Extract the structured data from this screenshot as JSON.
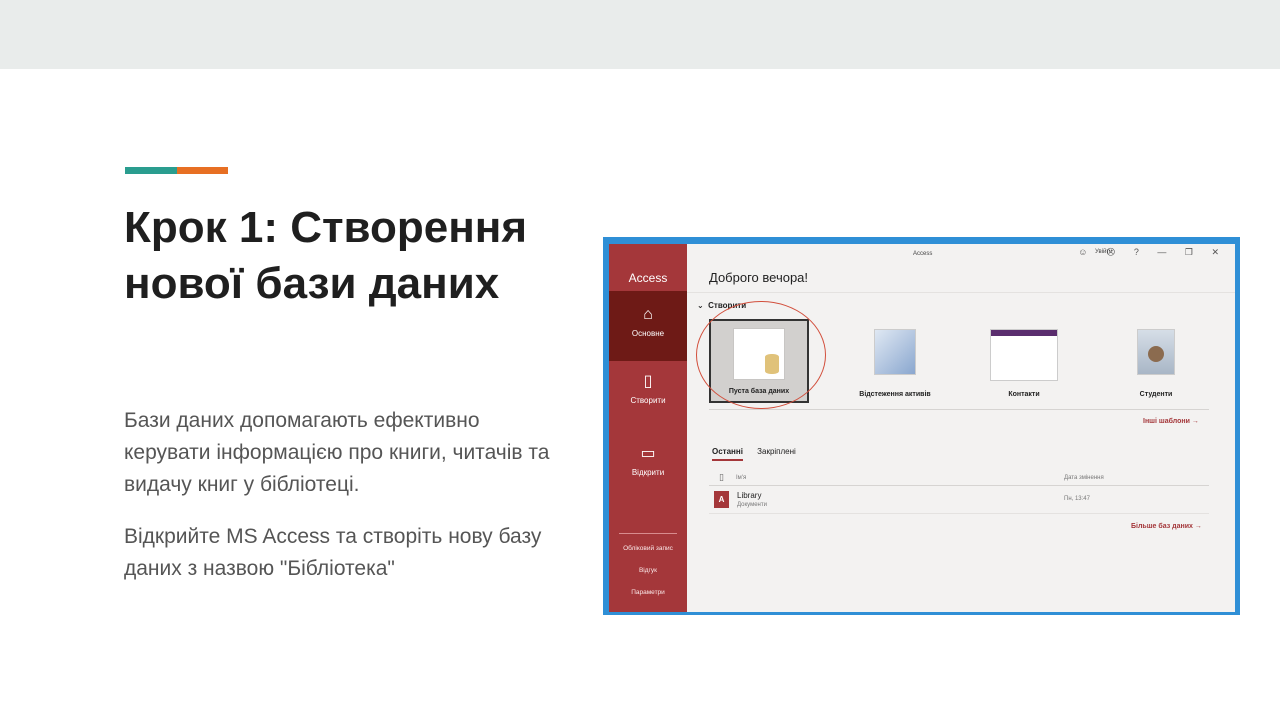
{
  "slide": {
    "title_line1": "Крок 1: Створення",
    "title_line2": "нової бази даних",
    "paragraph1": "Бази даних допомагають ефективно керувати інформацією про книги, читачів та видачу книг у бібліотеці.",
    "paragraph2": "Відкрийте MS Access та створіть нову базу даних з назвою \"Бібліотека\"",
    "accent_colors": [
      "#2a9d8f",
      "#e76f23"
    ]
  },
  "access": {
    "window_title": "Access",
    "user": "Увійти",
    "window_controls": "☺ ☹ ? — ❐ ✕",
    "nav": {
      "app_name": "Access",
      "items": [
        {
          "label": "Основне",
          "icon": "home-icon"
        },
        {
          "label": "Створити",
          "icon": "new-file-icon"
        },
        {
          "label": "Відкрити",
          "icon": "folder-icon"
        }
      ],
      "bottom": [
        "Обліковий запис",
        "Відгук",
        "Параметри"
      ]
    },
    "greeting": "Доброго вечора!",
    "section_toggle": "⌄",
    "section_title": "Створити",
    "templates": [
      {
        "label": "Пуста база даних"
      },
      {
        "label": "Відстеження активів"
      },
      {
        "label": "Контакти"
      },
      {
        "label": "Студенти"
      }
    ],
    "more_templates": "Інші шаблони →",
    "tabs": [
      "Останні",
      "Закріплені"
    ],
    "columns": [
      "Ім'я",
      "Дата змінення"
    ],
    "files": [
      {
        "name": "Library",
        "type": "Документи",
        "date": "Пн, 13:47",
        "icon_letter": "A"
      }
    ],
    "more_databases": "Більше баз даних →"
  }
}
